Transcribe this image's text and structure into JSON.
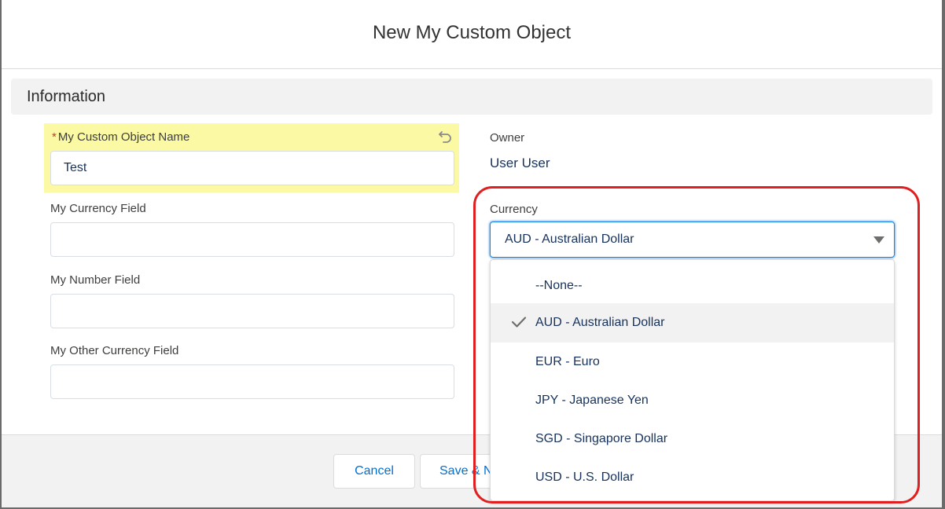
{
  "modal": {
    "title": "New My Custom Object"
  },
  "section": {
    "title": "Information"
  },
  "fields": {
    "name": {
      "required_marker": "*",
      "label": "My Custom Object Name",
      "value": "Test"
    },
    "currency_field": {
      "label": "My Currency Field",
      "value": ""
    },
    "number_field": {
      "label": "My Number Field",
      "value": ""
    },
    "other_currency_field": {
      "label": "My Other Currency Field",
      "value": ""
    },
    "owner": {
      "label": "Owner",
      "value": "User User"
    },
    "currency": {
      "label": "Currency",
      "selected": "AUD - Australian Dollar",
      "options": [
        "--None--",
        "AUD - Australian Dollar",
        "EUR - Euro",
        "JPY - Japanese Yen",
        "SGD - Singapore Dollar",
        "USD - U.S. Dollar"
      ]
    }
  },
  "footer": {
    "cancel_label": "Cancel",
    "save_new_label": "Save & New"
  },
  "colors": {
    "highlight": "#fbf9a3",
    "annotation": "#e02020",
    "link_blue": "#0070d2",
    "focus_border": "#1589ee"
  },
  "icons": {
    "undo": "undo-icon",
    "caret": "chevron-down-icon",
    "check": "check-icon"
  }
}
